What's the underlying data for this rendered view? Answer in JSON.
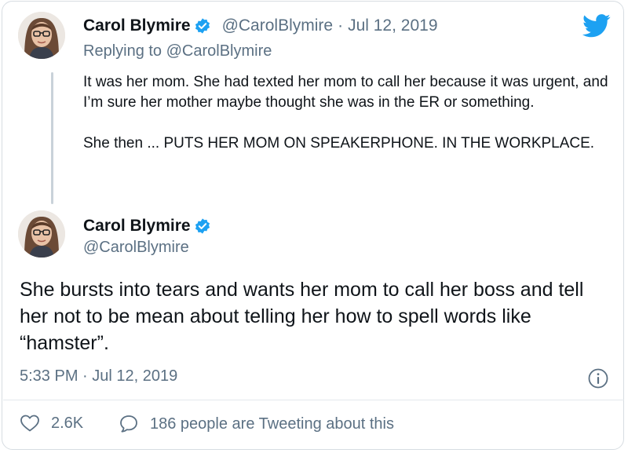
{
  "parent_tweet": {
    "author_name": "Carol Blymire",
    "author_handle": "@CarolBlymire",
    "separator": "·",
    "date": "Jul 12, 2019",
    "replying_prefix": "Replying to",
    "replying_handle": "@CarolBlymire",
    "paragraph_1": "It was her mom. She had texted her mom to call her because it was urgent, and I’m sure her mother maybe thought she was in the ER or something.",
    "paragraph_2": "She then ... PUTS HER MOM ON SPEAKERPHONE.  IN THE WORKPLACE."
  },
  "main_tweet": {
    "author_name": "Carol Blymire",
    "author_handle": "@CarolBlymire",
    "text": "She bursts into tears and wants her mom to call her boss and tell her not to be mean about telling her how to spell words like “hamster”.",
    "timestamp": "5:33 PM · Jul 12, 2019"
  },
  "actions": {
    "likes": "2.6K",
    "conversation": "186 people are Tweeting about this"
  },
  "icons": {
    "brand": "twitter-bird-icon",
    "verified": "verified-badge-icon",
    "info": "info-icon",
    "like": "heart-icon",
    "reply": "speech-bubble-icon"
  },
  "colors": {
    "brand_blue": "#1da1f2",
    "text_primary": "#0f1419",
    "text_secondary": "#5b7083",
    "thread_line": "#c9d2d9"
  }
}
